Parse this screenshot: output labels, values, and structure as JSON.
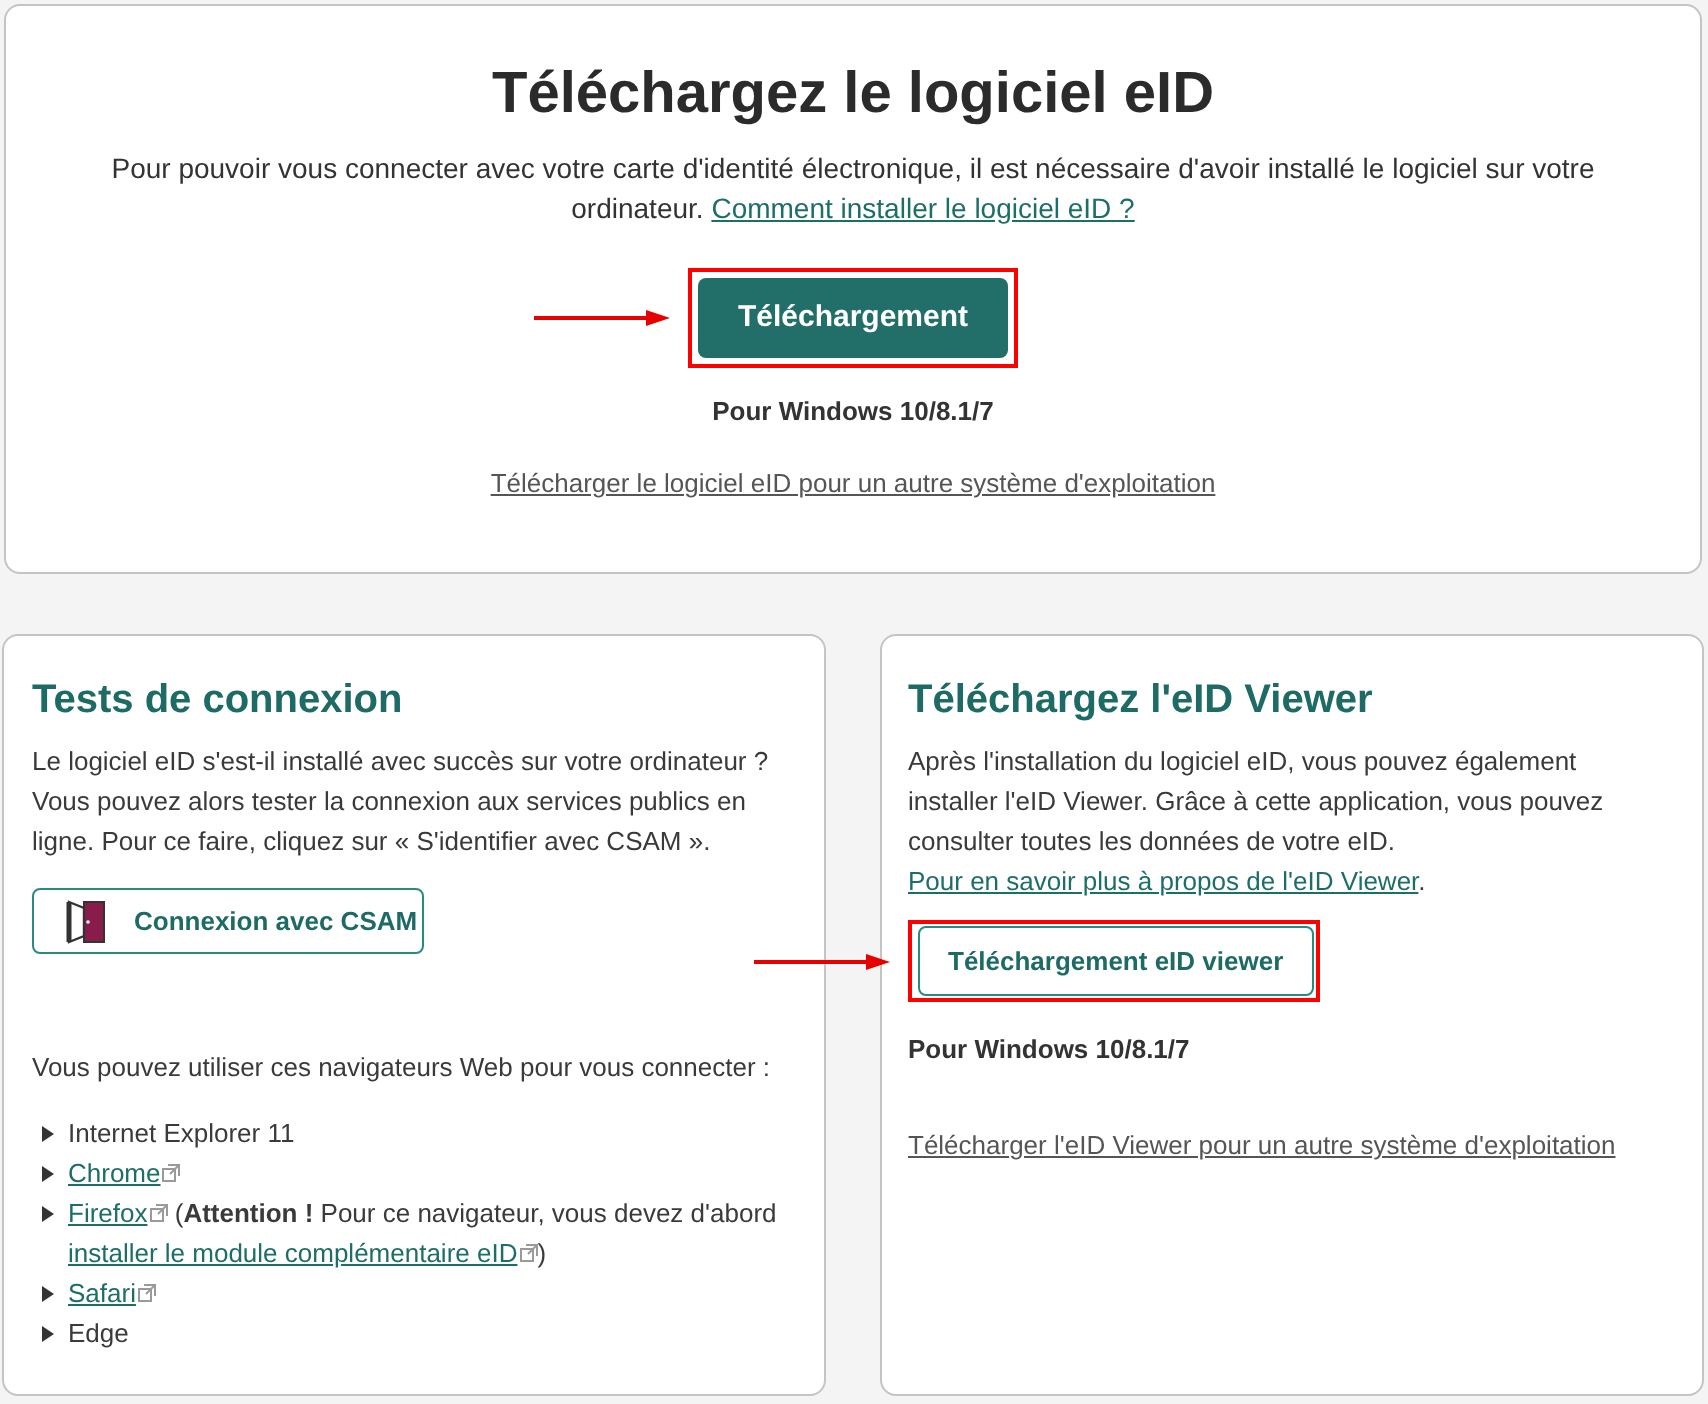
{
  "main_download": {
    "title": "Téléchargez le logiciel eID",
    "description": "Pour pouvoir vous connecter avec votre carte d'identité électronique, il est nécessaire d'avoir installé le logiciel sur votre ordinateur.",
    "description_link": "Comment installer le logiciel eID ?",
    "button": {
      "kind": "filled",
      "label": "Téléchargement",
      "highlighted": true
    },
    "platform": "Pour Windows 10/8.1/7",
    "other_os_link": "Télécharger le logiciel eID pour un autre système d'exploitation"
  },
  "connection_tests": {
    "title": "Tests de connexion",
    "description": "Le logiciel eID s'est-il installé avec succès sur votre ordinateur ? Vous pouvez alors tester la connexion aux services publics en ligne. Pour ce faire, cliquez sur « S'identifier avec CSAM ».",
    "button": {
      "kind": "outlined",
      "label": "Connexion avec CSAM"
    },
    "browsers_intro": "Vous pouvez utiliser ces navigateurs Web pour vous connecter :",
    "browsers": [
      {
        "kind": "text",
        "label": "Internet Explorer 11"
      },
      {
        "kind": "link",
        "label": "Chrome",
        "external": true
      },
      {
        "kind": "link",
        "label": "Firefox",
        "external": true,
        "note": "(**Attention !** Pour ce navigateur, vous devez d'abord",
        "note_link": "installer le module complémentaire eID",
        "note_link_external": true,
        "note_end": ")"
      },
      {
        "kind": "link",
        "label": "Safari",
        "external": true
      },
      {
        "kind": "text",
        "label": "Edge"
      }
    ]
  },
  "viewer_download": {
    "title": "Téléchargez l'eID Viewer",
    "description": "Après l'installation du logiciel eID, vous pouvez également installer l'eID Viewer. Grâce à cette application, vous pouvez consulter toutes les données de votre eID.",
    "description_link": "Pour en savoir plus à propos de l'eID Viewer",
    "description_end": ".",
    "button": {
      "kind": "outlined",
      "label": "Téléchargement eID viewer",
      "highlighted": true
    },
    "platform": "Pour Windows 10/8.1/7",
    "other_os_link": "Télécharger l'eID Viewer pour un autre système d'exploitation"
  }
}
